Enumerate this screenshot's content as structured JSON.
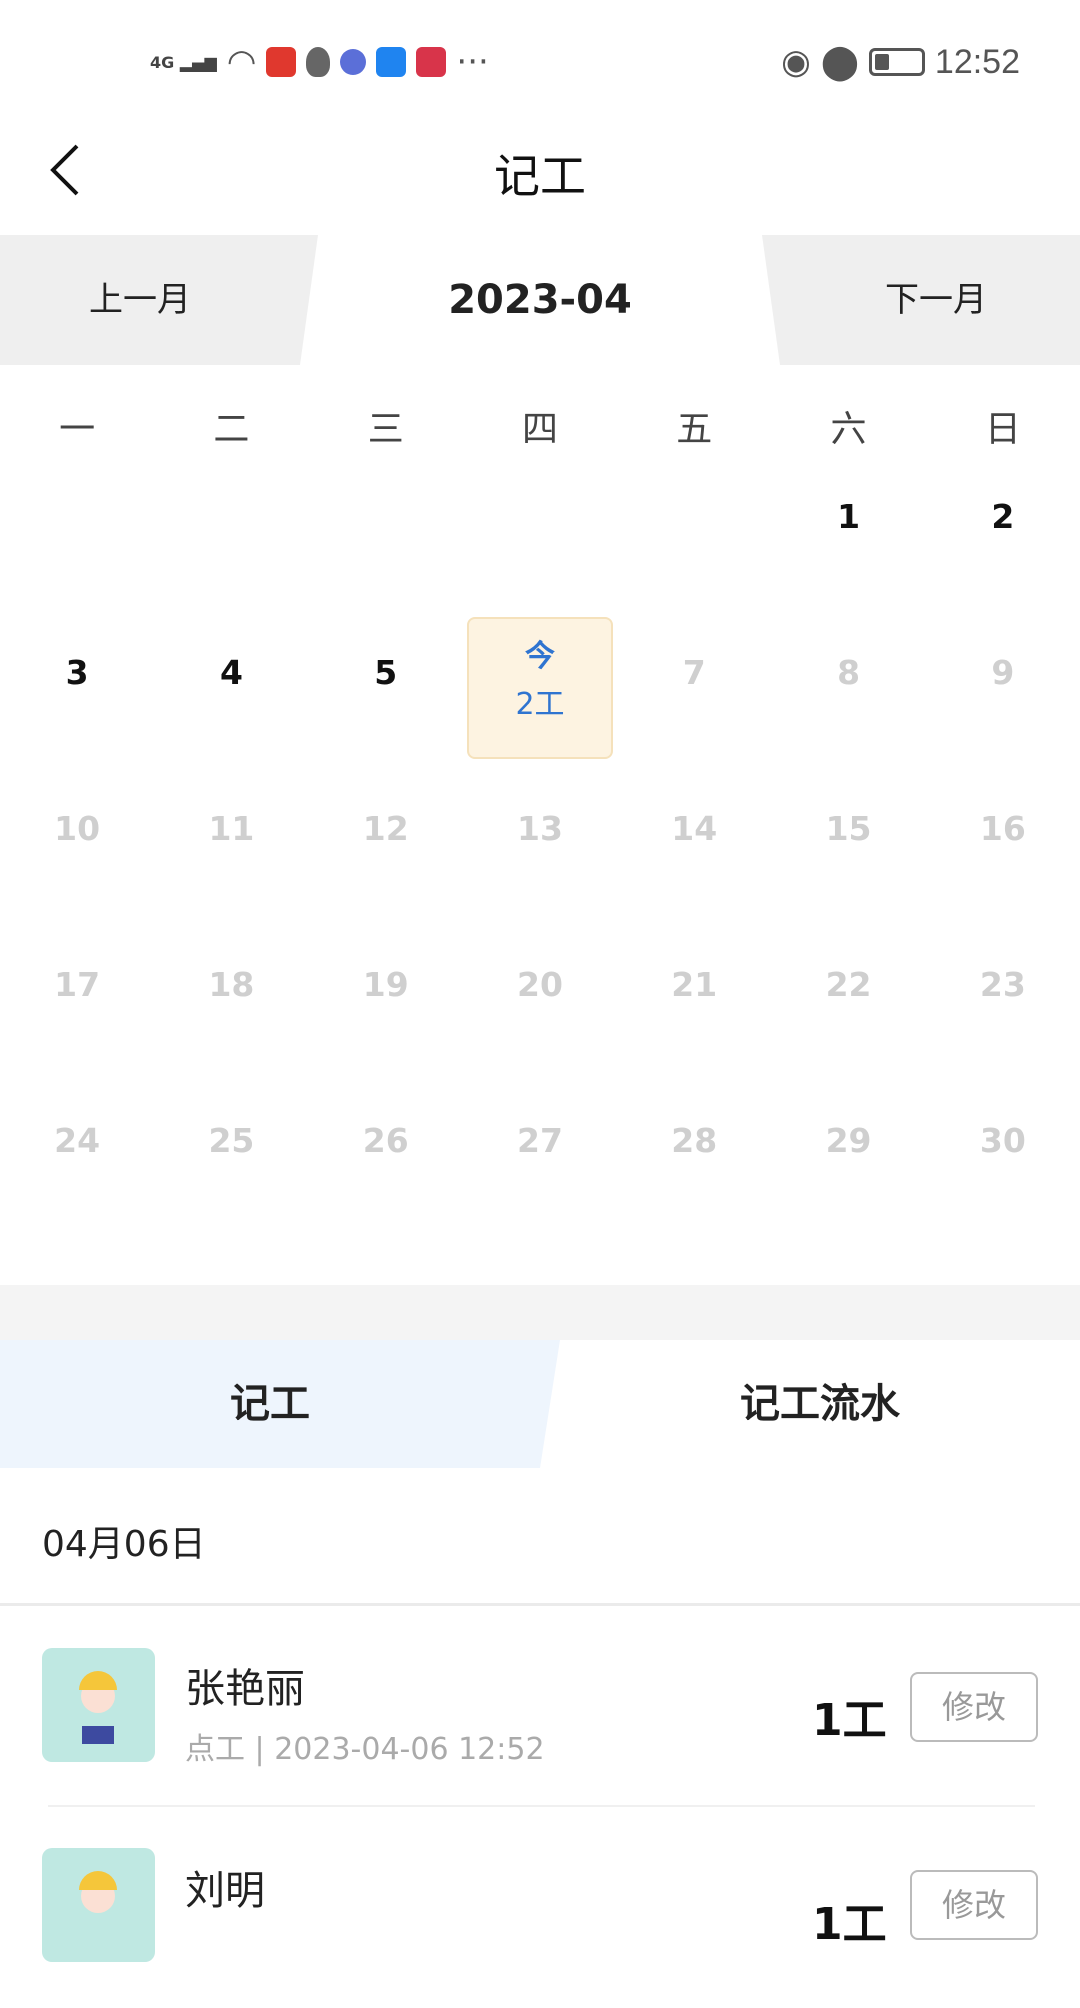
{
  "status_bar": {
    "network": "4G",
    "time": "12:52",
    "icons": [
      "signal-icon",
      "wifi-icon",
      "app-icon",
      "shield-user-icon",
      "music-icon",
      "weather-icon",
      "book-icon",
      "more-icon",
      "eye-icon",
      "location-icon",
      "battery-icon"
    ]
  },
  "header": {
    "title": "记工",
    "back_icon": "chevron-left-icon"
  },
  "month_switcher": {
    "prev": "上一月",
    "current": "2023-04",
    "next": "下一月"
  },
  "weekdays": [
    "一",
    "二",
    "三",
    "四",
    "五",
    "六",
    "日"
  ],
  "calendar": {
    "rows": [
      [
        "",
        "",
        "",
        "",
        "",
        "1",
        "2"
      ],
      [
        "3",
        "4",
        "5",
        "",
        "7",
        "8",
        "9"
      ],
      [
        "10",
        "11",
        "12",
        "13",
        "14",
        "15",
        "16"
      ],
      [
        "17",
        "18",
        "19",
        "20",
        "21",
        "22",
        "23"
      ],
      [
        "24",
        "25",
        "26",
        "27",
        "28",
        "29",
        "30"
      ]
    ],
    "today": {
      "label": "今",
      "work": "2工"
    },
    "colors": {
      "past": "#111111",
      "future": "#cfcfcf",
      "today_bg": "#fdf3e1",
      "today_text": "#2f74d0"
    }
  },
  "tabs": [
    {
      "label": "记工",
      "active": true
    },
    {
      "label": "记工流水",
      "active": false
    }
  ],
  "date_label": "04月06日",
  "records": [
    {
      "name": "张艳丽",
      "type": "点工",
      "time": "2023-04-06 12:52",
      "count": "1工",
      "action": "修改"
    },
    {
      "name": "刘明",
      "count": "1工",
      "action": "修改"
    }
  ]
}
